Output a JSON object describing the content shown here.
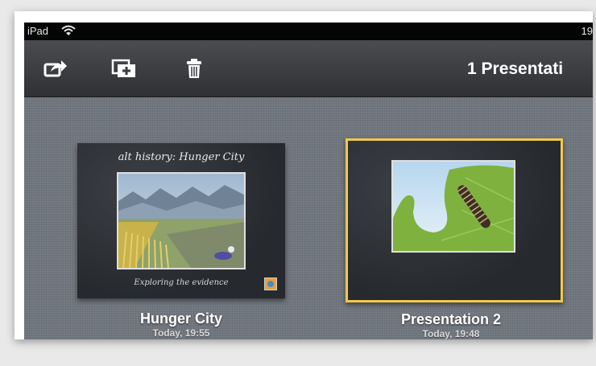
{
  "status_bar": {
    "carrier": "iPad",
    "time": "19"
  },
  "toolbar": {
    "title": "1 Presentati",
    "icons": [
      "share-icon",
      "duplicate-icon",
      "trash-icon"
    ]
  },
  "presentations": [
    {
      "name": "Hunger City",
      "date": "Today, 19:55",
      "slide_title": "alt history: Hunger City",
      "slide_caption": "Exploring the evidence",
      "selected": false
    },
    {
      "name": "Presentation 2",
      "date": "Today, 19:48",
      "selected": true
    }
  ],
  "colors": {
    "selection": "#f2c94c",
    "toolbar": "#3a3c40",
    "background": "#6d737b"
  }
}
